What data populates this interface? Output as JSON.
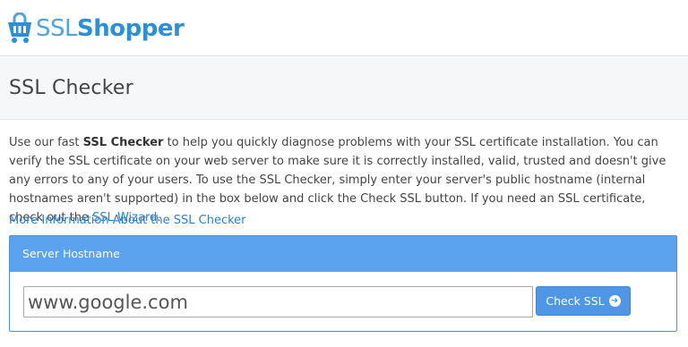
{
  "brand": {
    "name_part1": "SSL",
    "name_part2": "Shopper",
    "icon": "shopping-cart-lock-icon",
    "colors": {
      "primary": "#2b8fd9",
      "light": "#4ea3e0"
    }
  },
  "page": {
    "title": "SSL Checker"
  },
  "intro": {
    "t1": "Use our fast ",
    "bold": "SSL Checker",
    "t2": " to help you quickly diagnose problems with your SSL certificate installation. You can verify the SSL certificate on your web server to make sure it is correctly installed, valid, trusted and doesn't give any errors to any of your users. To use the SSL Checker, simply enter your server's public hostname (internal hostnames aren't supported) in the box below and click the Check SSL button. If you need an SSL certificate, check out the ",
    "link": "SSL Wizard",
    "t3": "."
  },
  "more_link": "More Information About the SSL Checker",
  "panel": {
    "heading": "Server Hostname",
    "input_value": "www.google.com",
    "button_label": "Check SSL",
    "button_icon": "arrow-circle-right-icon",
    "colors": {
      "header": "#5ba2ef",
      "button": "#4f97e6"
    }
  }
}
